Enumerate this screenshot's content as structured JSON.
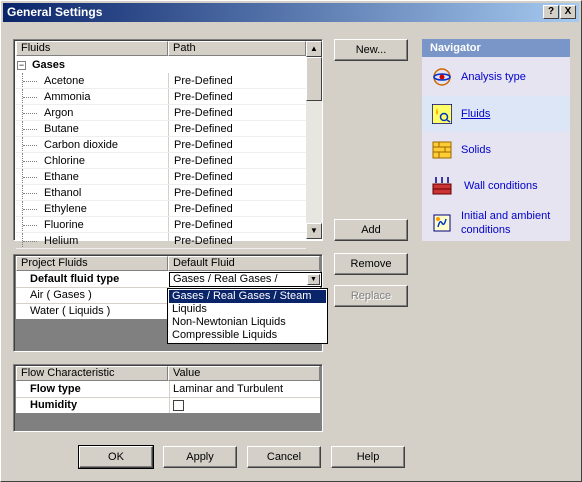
{
  "window": {
    "title": "General Settings",
    "help_btn": "?",
    "close_btn": "X"
  },
  "fluids_table": {
    "col_fluids": "Fluids",
    "col_path": "Path",
    "group": "Gases",
    "group_toggle": "−",
    "rows": [
      {
        "name": "Acetone",
        "path": "Pre-Defined"
      },
      {
        "name": "Ammonia",
        "path": "Pre-Defined"
      },
      {
        "name": "Argon",
        "path": "Pre-Defined"
      },
      {
        "name": "Butane",
        "path": "Pre-Defined"
      },
      {
        "name": "Carbon dioxide",
        "path": "Pre-Defined"
      },
      {
        "name": "Chlorine",
        "path": "Pre-Defined"
      },
      {
        "name": "Ethane",
        "path": "Pre-Defined"
      },
      {
        "name": "Ethanol",
        "path": "Pre-Defined"
      },
      {
        "name": "Ethylene",
        "path": "Pre-Defined"
      },
      {
        "name": "Fluorine",
        "path": "Pre-Defined"
      },
      {
        "name": "Helium",
        "path": "Pre-Defined"
      }
    ]
  },
  "buttons": {
    "new": "New...",
    "add": "Add",
    "remove": "Remove",
    "replace": "Replace",
    "ok": "OK",
    "apply": "Apply",
    "cancel": "Cancel",
    "help": "Help"
  },
  "project_table": {
    "col_project": "Project Fluids",
    "col_default": "Default Fluid",
    "default_type_label": "Default fluid type",
    "default_type_value": "Gases / Real Gases /",
    "rows": [
      "Air ( Gases )",
      "Water ( Liquids )"
    ],
    "dropdown_options": [
      "Gases / Real Gases / Steam",
      "Liquids",
      "Non-Newtonian Liquids",
      "Compressible Liquids"
    ],
    "selected_option": "Gases / Real Gases / Steam"
  },
  "flow_table": {
    "col_characteristic": "Flow Characteristic",
    "col_value": "Value",
    "rows": [
      {
        "label": "Flow type",
        "value": "Laminar and Turbulent"
      },
      {
        "label": "Humidity",
        "value": ""
      }
    ]
  },
  "navigator": {
    "title": "Navigator",
    "items": [
      {
        "label": "Analysis type",
        "icon": "analysis-type-icon"
      },
      {
        "label": "Fluids",
        "icon": "fluids-icon"
      },
      {
        "label": "Solids",
        "icon": "solids-icon"
      },
      {
        "label": "Wall conditions",
        "icon": "wall-conditions-icon"
      },
      {
        "label": "Initial and ambient conditions",
        "icon": "initial-conditions-icon"
      }
    ]
  },
  "colors": {
    "titlebar": "#0a246a",
    "selection": "#0a246a",
    "navigator_header": "#7a96c8",
    "link": "#0000cc"
  }
}
